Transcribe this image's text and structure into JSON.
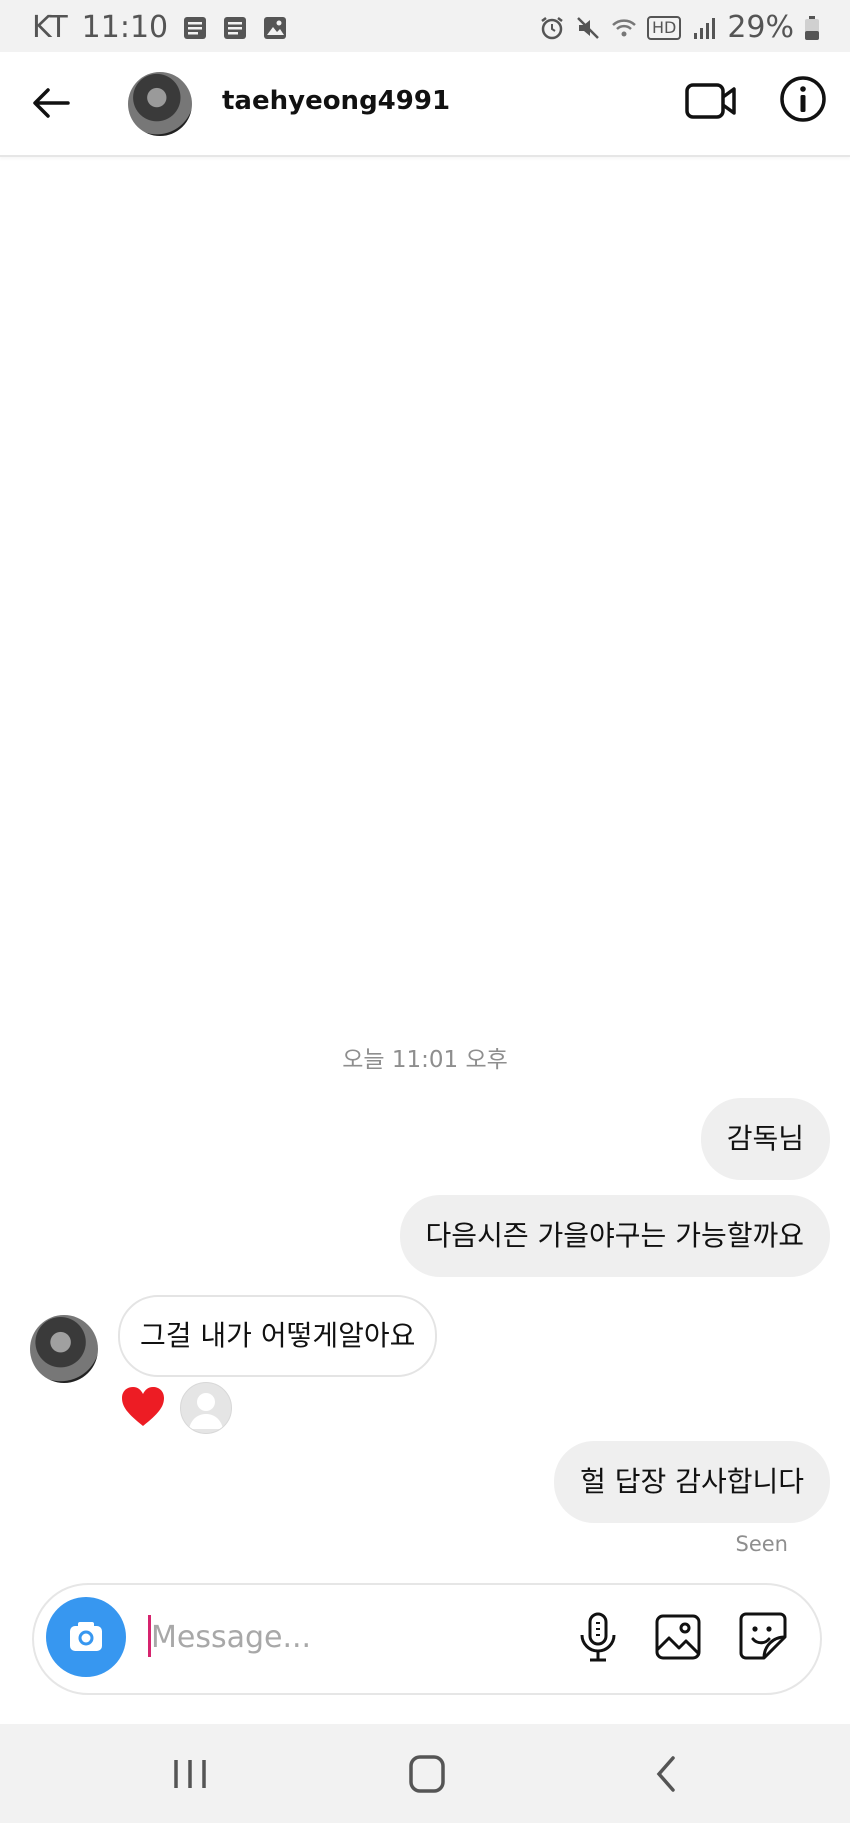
{
  "status_bar": {
    "carrier": "KT",
    "time": "11:10",
    "battery": "29%",
    "hd_label": "HD"
  },
  "header": {
    "username": "taehyeong4991",
    "icons": [
      "back-arrow-icon",
      "video-camera-icon",
      "info-icon"
    ]
  },
  "chat": {
    "timestamp": "오늘 11:01 오후",
    "messages": [
      {
        "side": "outgoing",
        "text": "감독님"
      },
      {
        "side": "outgoing",
        "text": "다음시즌 가을야구는 가능할까요"
      },
      {
        "side": "incoming",
        "text": "그걸 내가 어떻게알아요"
      },
      {
        "side": "outgoing",
        "text": "헐 답장 감사합니다"
      }
    ],
    "reaction_icon": "heart-icon",
    "seen_label": "Seen"
  },
  "composer": {
    "placeholder": "Message...",
    "value": ""
  },
  "colors": {
    "accent_blue": "#3797f0",
    "heart_red": "#ed1c24",
    "outgoing_bubble": "#efefef",
    "caret": "#d6246e"
  }
}
